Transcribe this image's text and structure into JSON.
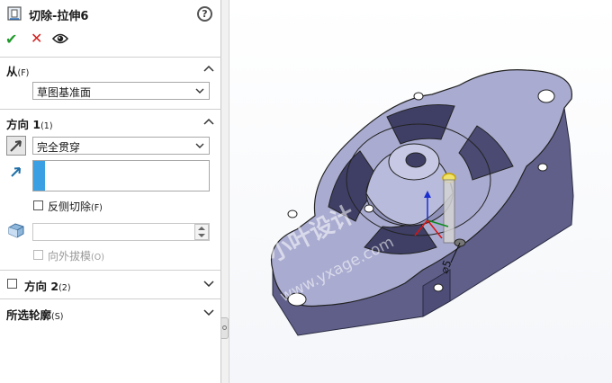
{
  "header": {
    "title": "切除-拉伸6",
    "help_symbol": "?"
  },
  "actions": {
    "ok_icon": "check-icon",
    "cancel_icon": "close-icon",
    "preview_icon": "eye-icon"
  },
  "from": {
    "title": "从",
    "title_suffix": "(F)",
    "selected": "草图基准面"
  },
  "direction1": {
    "title": "方向 1",
    "title_suffix": "(1)",
    "end_condition": "完全贯穿",
    "flip_side_label": "反侧切除",
    "flip_side_suffix": "(F)",
    "draft_outward_label": "向外拔模",
    "draft_outward_suffix": "(O)"
  },
  "direction2": {
    "title": "方向 2",
    "title_suffix": "(2)"
  },
  "selected_contours": {
    "title": "所选轮廓",
    "title_suffix": "(S)"
  },
  "viewport": {
    "watermark_line1": "小叶设计",
    "watermark_line2": "www.yxage.com",
    "dimension_label": "⌀5"
  },
  "colors": {
    "part_face": "#a9abd0",
    "part_side": "#5f5f8a",
    "accent": "#2e9ad6"
  }
}
